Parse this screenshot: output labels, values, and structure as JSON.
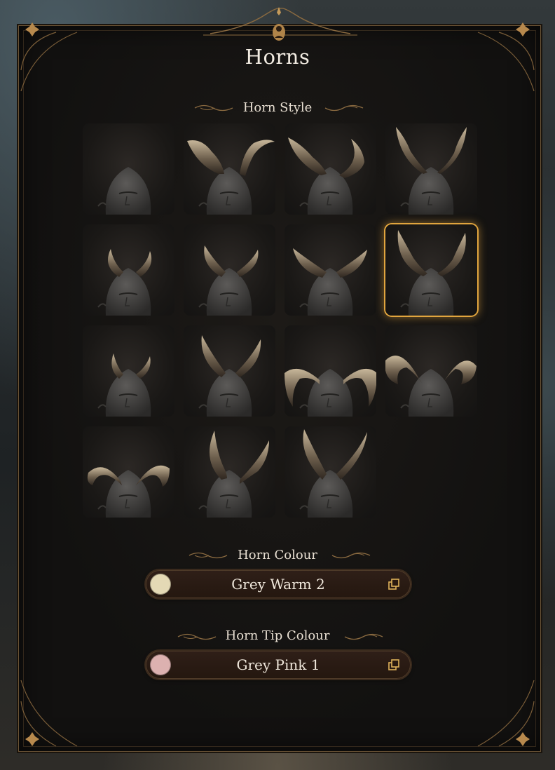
{
  "panel": {
    "title": "Horns"
  },
  "horn_style": {
    "label": "Horn Style",
    "selected_index": 7,
    "options": [
      {
        "style": "none"
      },
      {
        "style": "curled-twisted"
      },
      {
        "style": "sweeping-ridged"
      },
      {
        "style": "tall-spiked"
      },
      {
        "style": "short-curved"
      },
      {
        "style": "medium-swept"
      },
      {
        "style": "wide-swept"
      },
      {
        "style": "tall-curved"
      },
      {
        "style": "small-ridged"
      },
      {
        "style": "upright-ridged"
      },
      {
        "style": "ram-wide"
      },
      {
        "style": "ram-heavy"
      },
      {
        "style": "ram-low"
      },
      {
        "style": "long-arched"
      },
      {
        "style": "long-straight"
      }
    ]
  },
  "horn_colour": {
    "label": "Horn Colour",
    "value": "Grey Warm 2",
    "swatch": "#e4d9b5"
  },
  "horn_tip_colour": {
    "label": "Horn Tip Colour",
    "value": "Grey Pink 1",
    "swatch": "#dcb1b0"
  },
  "colors": {
    "accent": "#e1a53e",
    "frame": "#6b5436"
  },
  "icons": {
    "top_emblem": "portrait-emblem-icon",
    "picker_action": "copy-icon"
  }
}
